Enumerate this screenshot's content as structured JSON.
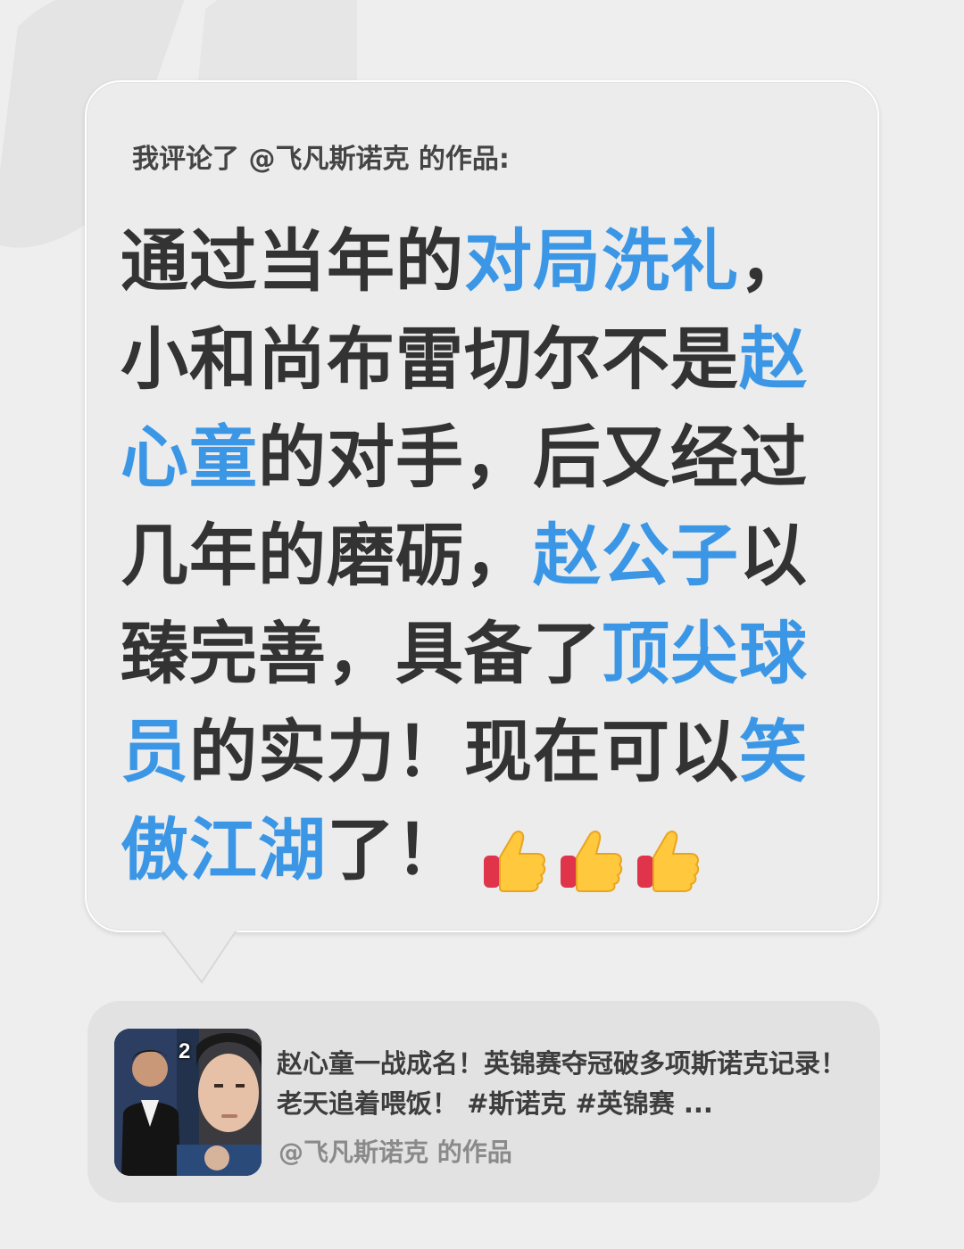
{
  "comment": {
    "header": "我评论了 @飞凡斯诺克 的作品:",
    "segments": [
      {
        "text": "通过当年的",
        "highlight": false
      },
      {
        "text": "对局洗礼",
        "highlight": true
      },
      {
        "text": "，小和尚布雷切尔不是",
        "highlight": false
      },
      {
        "text": "赵心童",
        "highlight": true
      },
      {
        "text": "的对手，后又经过几年的磨砺，",
        "highlight": false
      },
      {
        "text": "赵公子",
        "highlight": true
      },
      {
        "text": "以臻完善，具备了",
        "highlight": false
      },
      {
        "text": "顶尖球员",
        "highlight": true
      },
      {
        "text": "的实力！现在可以",
        "highlight": false
      },
      {
        "text": "笑傲江湖",
        "highlight": true
      },
      {
        "text": "了！",
        "highlight": false
      }
    ],
    "emojis": [
      "thumbs-up-icon",
      "thumbs-up-icon",
      "thumbs-up-icon"
    ]
  },
  "video_card": {
    "thumbnail_badge": "2",
    "title": "赵心童一战成名！英锦赛夺冠破多项斯诺克记录！老天追着喂饭！ #斯诺克 #英锦赛 ...",
    "author": "@飞凡斯诺克 的作品"
  },
  "colors": {
    "highlight": "#3b97e6",
    "text": "#333333",
    "background": "#eeeeee"
  }
}
